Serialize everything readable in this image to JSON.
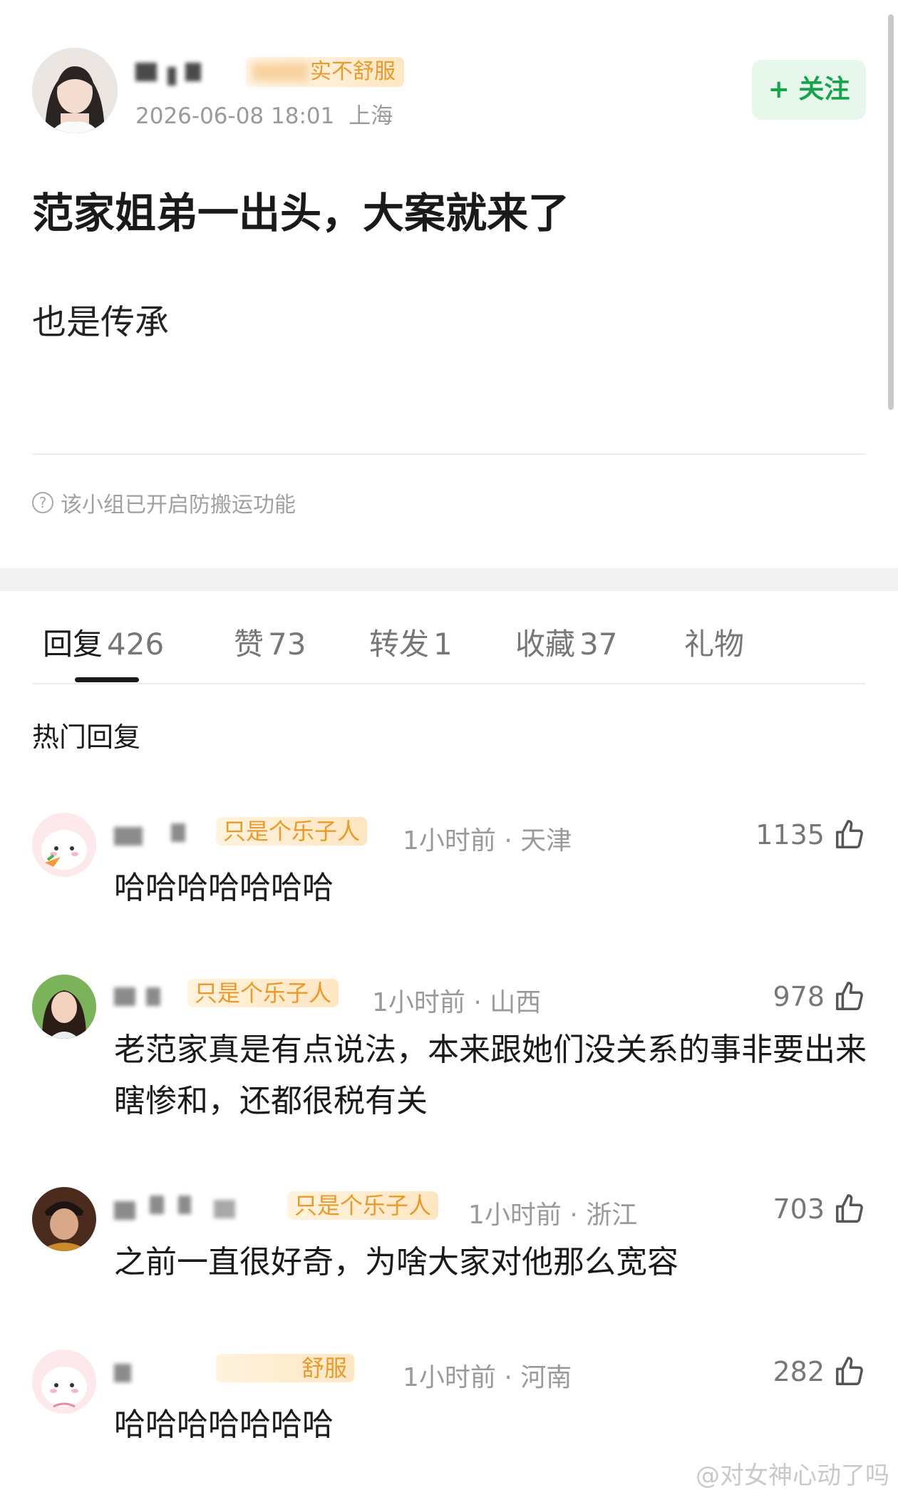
{
  "post": {
    "author_badge": "实不舒服",
    "timestamp": "2026-06-08 18:01",
    "location": "上海",
    "follow_label": "+ 关注",
    "title": "范家姐弟一出头，大案就来了",
    "body": "也是传承",
    "notice": "该小组已开启防搬运功能"
  },
  "tabs": [
    {
      "label": "回复",
      "count": "426"
    },
    {
      "label": "赞",
      "count": "73"
    },
    {
      "label": "转发",
      "count": "1"
    },
    {
      "label": "收藏",
      "count": "37"
    },
    {
      "label": "礼物",
      "count": ""
    }
  ],
  "section_title": "热门回复",
  "comments": [
    {
      "badge": "只是个乐子人",
      "time": "1小时前",
      "location": "天津",
      "likes": "1135",
      "text": "哈哈哈哈哈哈哈"
    },
    {
      "badge": "只是个乐子人",
      "time": "1小时前",
      "location": "山西",
      "likes": "978",
      "text": "老范家真是有点说法，本来跟她们没关系的事非要出来瞎惨和，还都很税有关"
    },
    {
      "badge": "只是个乐子人",
      "time": "1小时前",
      "location": "浙江",
      "likes": "703",
      "text": "之前一直很好奇，为啥大家对他那么宽容"
    },
    {
      "badge": "舒服",
      "time": "1小时前",
      "location": "河南",
      "likes": "282",
      "text": "哈哈哈哈哈哈哈"
    }
  ],
  "watermark": "@对女神心动了吗"
}
